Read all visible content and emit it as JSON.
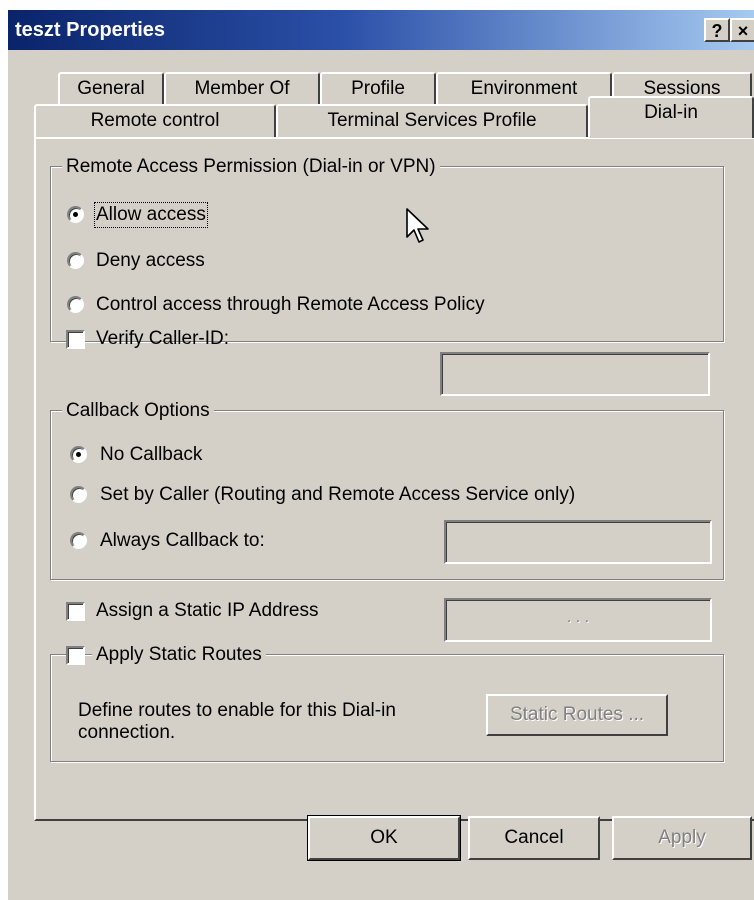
{
  "window": {
    "title": "teszt Properties",
    "help_label": "?",
    "close_label": "×"
  },
  "tabs": {
    "row1": [
      "General",
      "Member Of",
      "Profile",
      "Environment",
      "Sessions"
    ],
    "row2": [
      "Remote control",
      "Terminal Services Profile",
      "Dial-in"
    ],
    "active": "Dial-in"
  },
  "remote_access": {
    "legend": "Remote Access Permission (Dial-in or VPN)",
    "options": [
      "Allow access",
      "Deny access",
      "Control access through Remote Access Policy"
    ],
    "selected": "Allow access"
  },
  "verify_caller": {
    "label": "Verify Caller-ID:",
    "checked": false,
    "value": ""
  },
  "callback": {
    "legend": "Callback Options",
    "options": [
      "No Callback",
      "Set by Caller (Routing and Remote Access Service only)",
      "Always Callback to:"
    ],
    "selected": "No Callback",
    "callback_number": ""
  },
  "static_ip": {
    "label": "Assign a Static IP Address",
    "checked": false,
    "ip_dots": ".  .  ."
  },
  "static_routes": {
    "legend": "Apply Static Routes",
    "checked": false,
    "description_line1": "Define routes to enable for this Dial-in",
    "description_line2": "connection.",
    "button_label": "Static Routes ..."
  },
  "buttons": {
    "ok": "OK",
    "cancel": "Cancel",
    "apply": "Apply"
  },
  "icons": {
    "cursor": "mouse-pointer-icon"
  },
  "colors": {
    "dialog_bg": "#d4d0c8",
    "title_start": "#0a246a",
    "title_end": "#a6caf0"
  }
}
